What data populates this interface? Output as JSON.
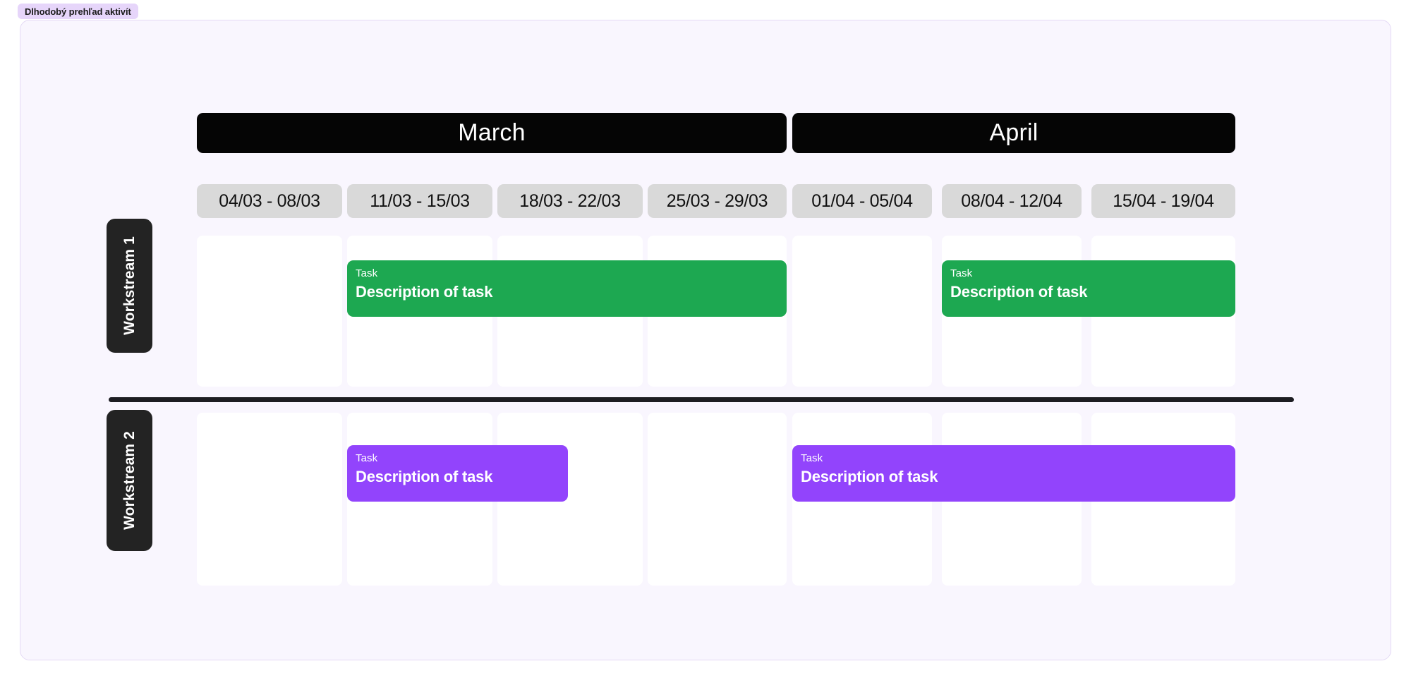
{
  "tab": {
    "label": "Dlhodobý prehľad aktivít"
  },
  "colors": {
    "page_background": "#ffffff",
    "board_background": "#f9f6fe",
    "board_border": "#e4d9f5",
    "tab_background": "#e6d5fa",
    "month_bar": "#050505",
    "week_chip": "#d9d9d9",
    "cell": "#ffffff",
    "workstream_label": "#232323",
    "divider": "#1d1d22",
    "task_green": "#1da851",
    "task_purple": "#9244fc"
  },
  "timeline": {
    "months": [
      {
        "name": "March",
        "week_span": 4
      },
      {
        "name": "April",
        "week_span": 3
      }
    ],
    "weeks": [
      {
        "label": "04/03 - 08/03"
      },
      {
        "label": "11/03 - 15/03"
      },
      {
        "label": "18/03 - 22/03"
      },
      {
        "label": "25/03 - 29/03"
      },
      {
        "label": "01/04 - 05/04"
      },
      {
        "label": "08/04 - 12/04"
      },
      {
        "label": "15/04 - 19/04"
      }
    ]
  },
  "workstreams": [
    {
      "label": "Workstream 1"
    },
    {
      "label": "Workstream 2"
    }
  ],
  "tasks": [
    {
      "kicker": "Task",
      "title": "Description of task",
      "workstream": "Workstream 1",
      "color": "#1da851",
      "start_week": "11/03 - 15/03",
      "end_week": "25/03 - 29/03"
    },
    {
      "kicker": "Task",
      "title": "Description of task",
      "workstream": "Workstream 1",
      "color": "#1da851",
      "start_week": "08/04 - 12/04",
      "end_week": "15/04 - 19/04"
    },
    {
      "kicker": "Task",
      "title": "Description of task",
      "workstream": "Workstream 2",
      "color": "#9244fc",
      "start_week": "11/03 - 15/03",
      "end_week": "18/03 - 22/03"
    },
    {
      "kicker": "Task",
      "title": "Description of task",
      "workstream": "Workstream 2",
      "color": "#9244fc",
      "start_week": "01/04 - 05/04",
      "end_week": "15/04 - 19/04"
    }
  ]
}
